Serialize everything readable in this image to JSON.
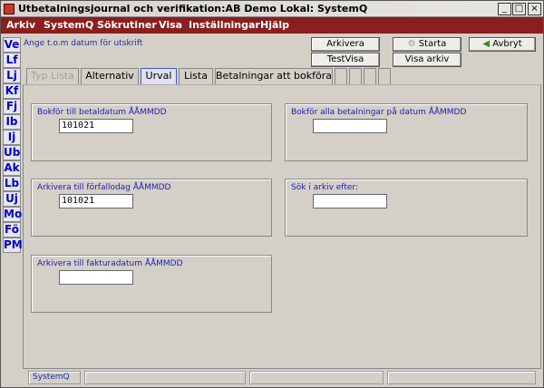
{
  "window": {
    "title": "Utbetalningsjournal och verifikation:AB Demo Lokal: SystemQ",
    "controls": [
      "_",
      "□",
      "×"
    ]
  },
  "menu": [
    "Arkiv",
    "SystemQ",
    "Sökrutiner",
    "Visa",
    "Inställningar",
    "Hjälp"
  ],
  "sidebar": [
    "Ve",
    "Lf",
    "Lj",
    "Kf",
    "Fj",
    "Ib",
    "Ij",
    "Ub",
    "Ak",
    "Lb",
    "Uj",
    "Mo",
    "Fö",
    "PM"
  ],
  "hint": "Ange t.o.m datum för utskrift",
  "toolbar": {
    "arkivera": "Arkivera",
    "testvisa": "TestVisa",
    "starta": "Starta",
    "visa_arkiv": "Visa arkiv",
    "avbryt": "Avbryt"
  },
  "tabs": [
    "Typ Lista",
    "Alternativ",
    "Urval",
    "Lista",
    "Betalningar att bokföra"
  ],
  "panels": {
    "bokfor_betaldatum": {
      "label": "Bokför till betaldatum  ÅÅMMDD",
      "value": "101021"
    },
    "bokfor_alla": {
      "label": "Bokför alla betalningar på datum  ÅÅMMDD",
      "value": ""
    },
    "arkivera_forfallodag": {
      "label": "Arkivera till förfallodag  ÅÅMMDD",
      "value": "101021"
    },
    "sok_arkiv": {
      "label": "Sök i arkiv efter:",
      "value": ""
    },
    "arkivera_fakturadatum": {
      "label": "Arkivera till fakturadatum  ÅÅMMDD",
      "value": ""
    }
  },
  "status": {
    "app": "SystemQ"
  }
}
